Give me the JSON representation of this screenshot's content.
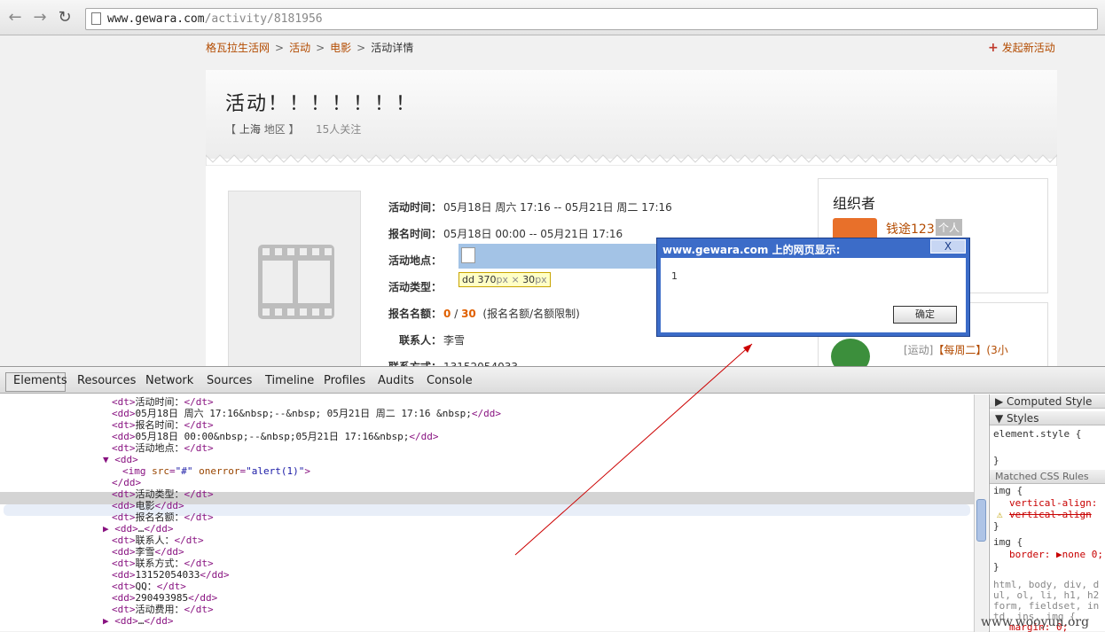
{
  "browser": {
    "url_host": "www.gewara.com",
    "url_path": "/activity/8181956"
  },
  "breadcrumb": [
    "格瓦拉生活网",
    "活动",
    "电影",
    "活动详情"
  ],
  "new_activity": "发起新活动",
  "event": {
    "title": "活动！！！！！！！",
    "region_open": "【",
    "region_city": "上海",
    "region_suffix": "地区 】",
    "followers": "15人关注",
    "fields": [
      {
        "label": "活动时间：",
        "value": "05月18日 周六 17:16 -- 05月21日 周二 17:16"
      },
      {
        "label": "报名时间：",
        "value": "05月18日 00:00 -- 05月21日 17:16"
      },
      {
        "label": "活动地点：",
        "value": ""
      },
      {
        "label": "活动类型：",
        "value": ""
      },
      {
        "label": "报名名额：",
        "value": ""
      },
      {
        "label": "联系人：",
        "value": "李雪"
      },
      {
        "label": "联系方式：",
        "value": "13152054033"
      }
    ],
    "quota_current": "0",
    "quota_sep": "/",
    "quota_total": "30",
    "quota_note": "(报名名额/名额限制)",
    "tooltip_tag": "dd",
    "tooltip_w": "370",
    "tooltip_h": "30",
    "tooltip_unit": "px",
    "tooltip_x": "×"
  },
  "organizer": {
    "title": "组织者",
    "name": "钱途123",
    "badge": "个人"
  },
  "related": {
    "text_prefix": "[运动]",
    "text_title": "【每周二】(",
    "text_suffix": "3小"
  },
  "dialog": {
    "title": "www.gewara.com 上的网页显示:",
    "close": "X",
    "message": "1",
    "ok": "确定"
  },
  "devtools": {
    "tabs": [
      "Elements",
      "Resources",
      "Network",
      "Sources",
      "Timeline",
      "Profiles",
      "Audits",
      "Console"
    ],
    "dom_lines": [
      {
        "indent": 1,
        "tag_open": "<dt>",
        "text": "活动时间：",
        "tag_close": "</dt>"
      },
      {
        "indent": 1,
        "tag_open": "<dd>",
        "text": "05月18日 周六 17:16&nbsp;--&nbsp; 05月21日 周二 17:16 &nbsp;",
        "tag_close": "</dd>"
      },
      {
        "indent": 1,
        "tag_open": "<dt>",
        "text": "报名时间：",
        "tag_close": "</dt>"
      },
      {
        "indent": 1,
        "tag_open": "<dd>",
        "text": "05月18日 00:00&nbsp;--&nbsp;05月21日 17:16&nbsp;",
        "tag_close": "</dd>"
      },
      {
        "indent": 1,
        "tag_open": "<dt>",
        "text": "活动地点：",
        "tag_close": "</dt>"
      },
      {
        "indent": 0,
        "tag_open": "▼ <dd>",
        "text": "",
        "tag_close": ""
      },
      {
        "indent": 2,
        "tag_open": "<img src=\"#\" onerror=\"alert(1)\">",
        "text": "",
        "tag_close": ""
      },
      {
        "indent": 1,
        "tag_open": "</dd>",
        "text": "",
        "tag_close": ""
      },
      {
        "indent": 1,
        "tag_open": "<dt>",
        "text": "活动类型：",
        "tag_close": "</dt>"
      },
      {
        "indent": 1,
        "tag_open": "<dd>",
        "text": "电影",
        "tag_close": "</dd>"
      },
      {
        "indent": 1,
        "tag_open": "<dt>",
        "text": "报名名额：",
        "tag_close": "</dt>"
      },
      {
        "indent": 0,
        "tag_open": "▶ <dd>",
        "text": "…",
        "tag_close": "</dd>"
      },
      {
        "indent": 1,
        "tag_open": "<dt>",
        "text": "联系人：",
        "tag_close": "</dt>"
      },
      {
        "indent": 1,
        "tag_open": "<dd>",
        "text": "李雪",
        "tag_close": "</dd>"
      },
      {
        "indent": 1,
        "tag_open": "<dt>",
        "text": "联系方式：",
        "tag_close": "</dt>"
      },
      {
        "indent": 1,
        "tag_open": "<dd>",
        "text": "13152054033",
        "tag_close": "</dd>"
      },
      {
        "indent": 1,
        "tag_open": "<dt>",
        "text": "QQ：",
        "tag_close": "</dt>"
      },
      {
        "indent": 1,
        "tag_open": "<dd>",
        "text": "290493985",
        "tag_close": "</dd>"
      },
      {
        "indent": 1,
        "tag_open": "<dt>",
        "text": "活动费用：",
        "tag_close": "</dt>"
      },
      {
        "indent": 0,
        "tag_open": "▶ <dd>",
        "text": "…",
        "tag_close": "</dd>"
      }
    ],
    "sidebar": {
      "computed": "Computed Style",
      "styles": "Styles",
      "element_style": "element.style {",
      "brace_close": "}",
      "matched": "Matched CSS Rules",
      "rule1_sel": "img {",
      "rule1_p1": "vertical-align:",
      "rule1_p2": "vertical-align",
      "rule2_sel": "img {",
      "rule2_p1": "border: ▶none 0;",
      "rule3_line1": "html, body, div, d",
      "rule3_line2": "ul, ol, li, h1, h2",
      "rule3_line3": "form, fieldset, in",
      "rule3_line4": "td, ins, img {",
      "rule3_line5": "margin: 0;"
    }
  },
  "watermark": "www.wooyun.org",
  "colors": {
    "link": "#b34b00",
    "accent": "#e06000",
    "dialog": "#3c6cc8",
    "arrow": "#cc0000"
  }
}
